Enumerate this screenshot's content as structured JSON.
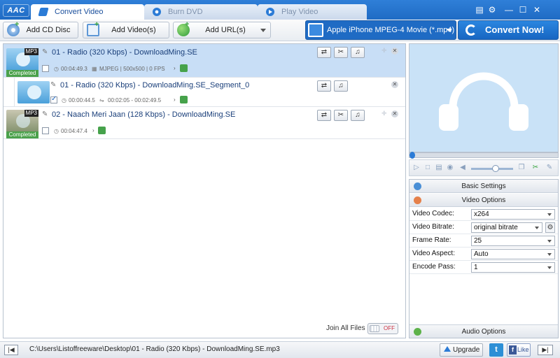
{
  "app": {
    "logo": "AAC"
  },
  "tabs": [
    {
      "label": "Convert Video",
      "active": true
    },
    {
      "label": "Burn DVD",
      "active": false
    },
    {
      "label": "Play Video",
      "active": false
    }
  ],
  "window_controls": {
    "menu": "▤",
    "settings": "⚙",
    "minimize": "—",
    "maximize": "☐",
    "close": "✕"
  },
  "toolbar": {
    "add_cd": "Add CD Disc",
    "add_videos": "Add Video(s)",
    "add_url": "Add URL(s)",
    "output_format": "Apple iPhone MPEG-4 Movie (*.mp4)",
    "convert": "Convert Now!"
  },
  "files": [
    {
      "title": "01 - Radio (320 Kbps) - DownloadMing.SE",
      "format_badge": "MP3",
      "status": "Completed",
      "duration": "00:04:49.3",
      "codec_info": "MJPEG | 500x500 | 0 FPS"
    },
    {
      "title": "01 - Radio (320 Kbps) - DownloadMing.SE_Segment_0",
      "duration": "00:00:44.5",
      "range": "00:02:05 - 00:02:49.5"
    },
    {
      "title": "02 - Naach Meri Jaan (128 Kbps) - DownloadMing.SE",
      "format_badge": "MP3",
      "status": "Completed",
      "duration": "00:04:47.4"
    }
  ],
  "join": {
    "label": "Join All Files",
    "state": "OFF"
  },
  "settings": {
    "basic_header": "Basic Settings",
    "video_header": "Video Options",
    "audio_header": "Audio Options",
    "rows": [
      {
        "label": "Video Codec:",
        "value": "x264"
      },
      {
        "label": "Video Bitrate:",
        "value": "original bitrate"
      },
      {
        "label": "Frame Rate:",
        "value": "25"
      },
      {
        "label": "Video Aspect:",
        "value": "Auto"
      },
      {
        "label": "Encode Pass:",
        "value": "1"
      }
    ]
  },
  "status": {
    "path": "C:\\Users\\Listoffreeware\\Desktop\\01 - Radio (320 Kbps) - DownloadMing.SE.mp3",
    "upgrade": "Upgrade",
    "twitter": "t",
    "like": "Like"
  },
  "colors": {
    "accent": "#1f6bc4",
    "selected_row": "#c8def6",
    "preview_bg": "#c9e2f7",
    "completed": "#4aa14b"
  }
}
